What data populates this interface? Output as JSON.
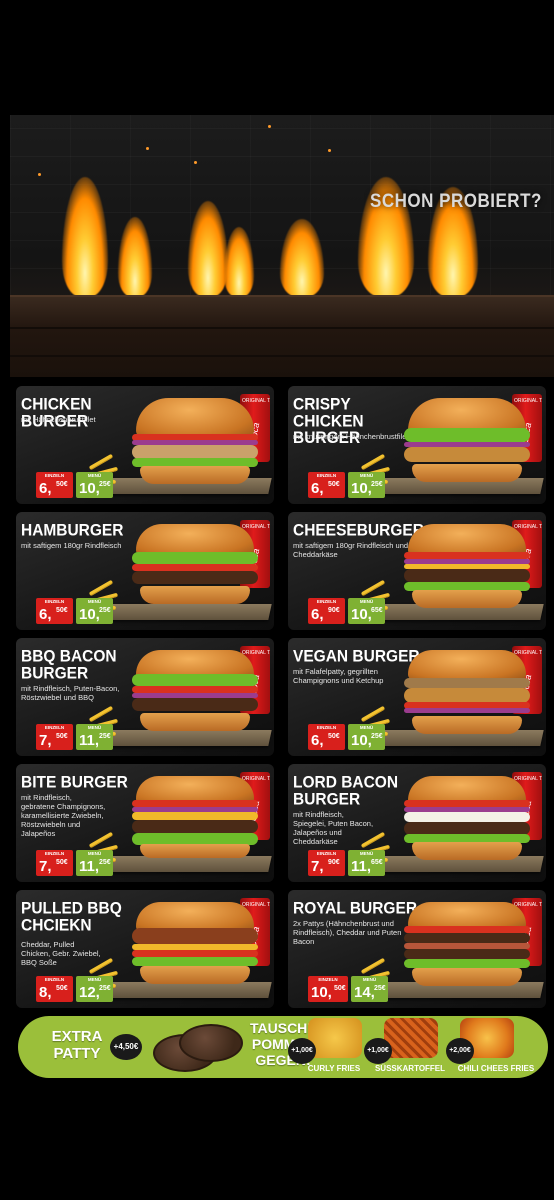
{
  "hero": {
    "tagline": "SCHON PROBIERT?"
  },
  "menu": {
    "single_label": "EINZELN",
    "menu_label": "MENÜ",
    "items": [
      {
        "name": "CHICKEN BURGER",
        "desc": "mit Hähnchenbrustfilet",
        "single": "6,",
        "single_c": "50€",
        "menu": "10,",
        "menu_c": "25€"
      },
      {
        "name": "CRISPY CHICKEN BURGER",
        "desc": "mit knusprigem Hähnchenbrustfilet",
        "single": "6,",
        "single_c": "50€",
        "menu": "10,",
        "menu_c": "25€"
      },
      {
        "name": "HAMBURGER",
        "desc": "mit saftigem 180gr Rindfleisch",
        "single": "6,",
        "single_c": "50€",
        "menu": "10,",
        "menu_c": "25€"
      },
      {
        "name": "CHEESEBURGER",
        "desc": "mit saftigem 180gr Rindfleisch und Cheddarkäse",
        "single": "6,",
        "single_c": "90€",
        "menu": "10,",
        "menu_c": "65€"
      },
      {
        "name": "BBQ BACON BURGER",
        "desc": "mit Rindfleisch, Puten-Bacon, Röstzwiebel und BBQ",
        "single": "7,",
        "single_c": "50€",
        "menu": "11,",
        "menu_c": "25€"
      },
      {
        "name": "VEGAN BURGER",
        "desc": "mit Falafelpatty, gegrillten Champignons und Ketchup",
        "single": "6,",
        "single_c": "50€",
        "menu": "10,",
        "menu_c": "25€"
      },
      {
        "name": "BITE BURGER",
        "desc": "mit Rindfleisch, gebratene Champignons, karamellisierte Zwiebeln, Röstzwiebeln und Jalapeños",
        "single": "7,",
        "single_c": "50€",
        "menu": "11,",
        "menu_c": "25€"
      },
      {
        "name": "LORD BACON BURGER",
        "desc": "mit Rindfleisch, Spiegelei, Puten Bacon, Jalapeños und Cheddarkäse",
        "single": "7,",
        "single_c": "90€",
        "menu": "11,",
        "menu_c": "65€"
      },
      {
        "name": "PULLED BBQ CHCIEKN",
        "desc": "Cheddar, Pulled Chicken, Gebr. Zwiebel, BBQ Soße",
        "single": "8,",
        "single_c": "50€",
        "menu": "12,",
        "menu_c": "25€"
      },
      {
        "name": "ROYAL BURGER",
        "desc": "2x Pattys (Hähnchenbrust und Rindfleisch), Cheddar und Puten Bacon",
        "single": "10,",
        "single_c": "50€",
        "menu": "14,",
        "menu_c": "25€"
      }
    ]
  },
  "extras": {
    "extra_patty": "EXTRA PATTY",
    "extra_patty_price": "+4,50€",
    "swap_title": "TAUSCHE POMMES GEGEN:",
    "sides": [
      {
        "label": "CURLY FRIES",
        "price": "+1,00€"
      },
      {
        "label": "SÜSSKARTOFFEL",
        "price": "+1,00€"
      },
      {
        "label": "CHILI CHEES FRIES",
        "price": "+2,00€"
      }
    ]
  },
  "colors": {
    "single_price_bg": "#d8201c",
    "menu_price_bg": "#7fb133",
    "extras_bar_bg": "#9bbf3a"
  }
}
